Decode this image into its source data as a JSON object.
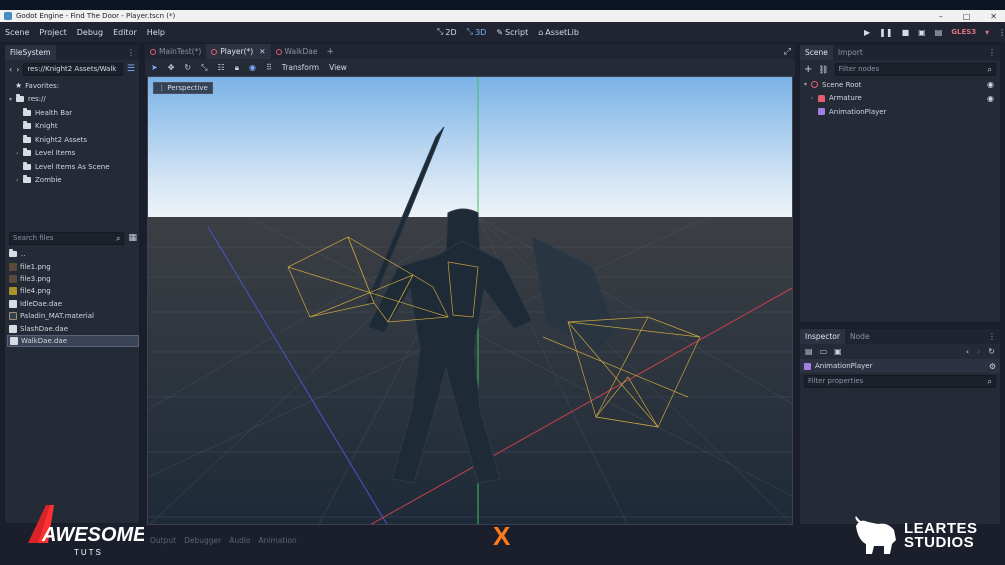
{
  "window": {
    "title": "Godot Engine - Find The Door - Player.tscn (*)",
    "controls": [
      "–",
      "□",
      "✕"
    ]
  },
  "menu": [
    "Scene",
    "Project",
    "Debug",
    "Editor",
    "Help"
  ],
  "modes": [
    {
      "label": "2D",
      "icon": "2d-icon",
      "active": false
    },
    {
      "label": "3D",
      "icon": "3d-icon",
      "active": true
    },
    {
      "label": "Script",
      "icon": "script-icon",
      "active": false
    },
    {
      "label": "AssetLib",
      "icon": "assetlib-icon",
      "active": false
    }
  ],
  "renderer": "GLES3",
  "filesystem": {
    "tab": "FileSystem",
    "path": "res://Knight2 Assets/Walk",
    "favorites_label": "Favorites:",
    "root": "res://",
    "folders": [
      "Health Bar",
      "Knight",
      "Knight2 Assets",
      "Level Items",
      "Level Items As Scene",
      "Zombie"
    ],
    "search_placeholder": "Search files",
    "files": [
      {
        "name": "..",
        "type": "folder"
      },
      {
        "name": "file1.png",
        "type": "png"
      },
      {
        "name": "file3.png",
        "type": "png"
      },
      {
        "name": "file4.png",
        "type": "png-yellow"
      },
      {
        "name": "IdleDae.dae",
        "type": "dae"
      },
      {
        "name": "Paladin_MAT.material",
        "type": "material"
      },
      {
        "name": "SlashDae.dae",
        "type": "dae"
      },
      {
        "name": "WalkDae.dae",
        "type": "dae",
        "selected": true
      }
    ]
  },
  "scene_tabs": [
    {
      "label": "MainTest(*)",
      "active": false
    },
    {
      "label": "Player(*)",
      "active": true
    },
    {
      "label": "WalkDae",
      "active": false
    }
  ],
  "viewport_toolbar": {
    "transform": "Transform",
    "view": "View"
  },
  "viewport": {
    "perspective_label": "Perspective"
  },
  "bottom_tabs": [
    "Output",
    "Debugger",
    "Audio",
    "Animation"
  ],
  "scene_dock": {
    "tabs": [
      "Scene",
      "Import"
    ],
    "filter_placeholder": "Filter nodes",
    "nodes": [
      {
        "label": "Scene Root",
        "icon": "spatial-node-icon",
        "depth": 0,
        "visible_eye": true
      },
      {
        "label": "Armature",
        "icon": "skeleton-node-icon",
        "depth": 1,
        "visible_eye": true
      },
      {
        "label": "AnimationPlayer",
        "icon": "animation-player-icon",
        "depth": 1,
        "visible_eye": false
      }
    ]
  },
  "inspector": {
    "tabs": [
      "Inspector",
      "Node"
    ],
    "object": "AnimationPlayer",
    "filter_placeholder": "Filter properties"
  },
  "watermarks": {
    "left_brand": "AWESOME",
    "left_sub": "TUTS",
    "right_brand_line1": "LEARTES",
    "right_brand_line2": "STUDIOS",
    "center_mark": "X"
  },
  "colors": {
    "accent": "#7bb0ff",
    "spatial": "#e06070",
    "anim": "#a27ee0",
    "bone": "#e0b840",
    "x_mark": "#ff7a1a"
  }
}
